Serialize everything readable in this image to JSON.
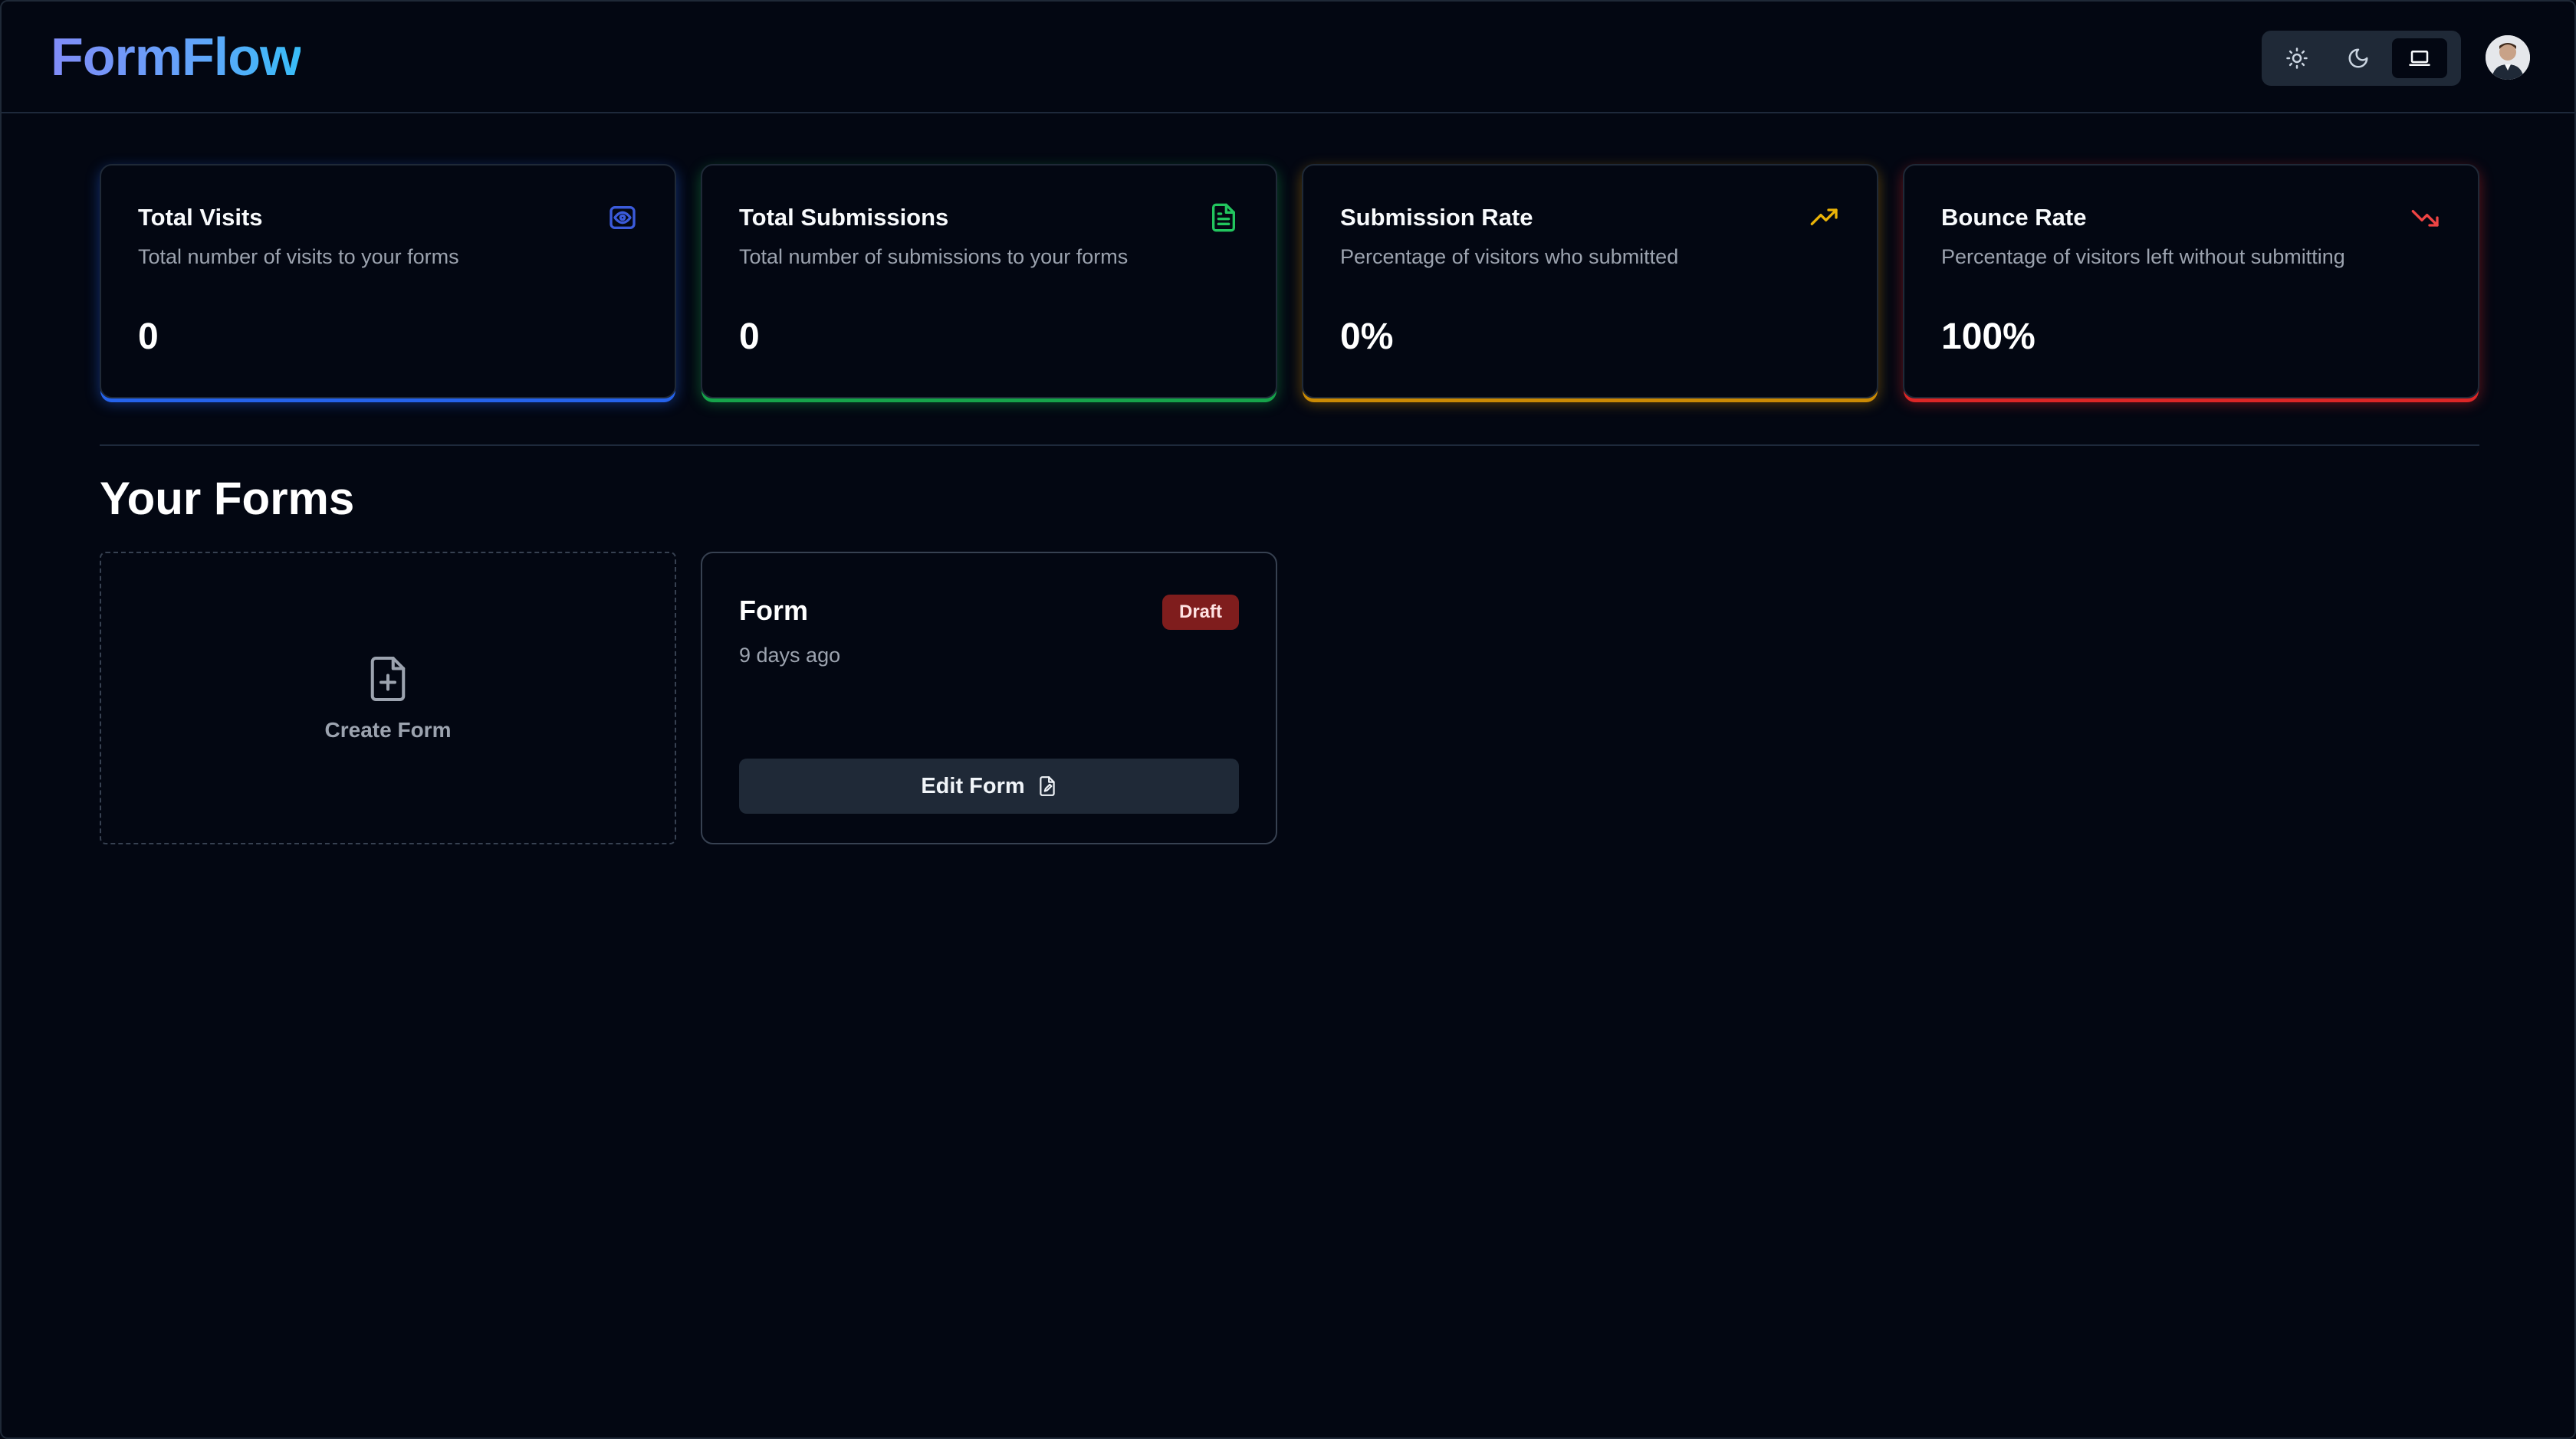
{
  "header": {
    "logo": "FormFlow",
    "theme_options": [
      "light",
      "dark",
      "system"
    ],
    "active_theme": "system"
  },
  "stats": [
    {
      "title": "Total Visits",
      "description": "Total number of visits to your forms",
      "value": "0",
      "icon": "eye-icon",
      "color": "#3b5bdb"
    },
    {
      "title": "Total Submissions",
      "description": "Total number of submissions to your forms",
      "value": "0",
      "icon": "file-text-icon",
      "color": "#22c55e"
    },
    {
      "title": "Submission Rate",
      "description": "Percentage of visitors who submitted",
      "value": "0%",
      "icon": "trending-up-icon",
      "color": "#eab308"
    },
    {
      "title": "Bounce Rate",
      "description": "Percentage of visitors left without submitting",
      "value": "100%",
      "icon": "trending-down-icon",
      "color": "#ef4444"
    }
  ],
  "forms_section": {
    "title": "Your Forms",
    "create_label": "Create Form",
    "forms": [
      {
        "name": "Form",
        "status": "Draft",
        "updated": "9 days ago",
        "action_label": "Edit Form"
      }
    ]
  }
}
